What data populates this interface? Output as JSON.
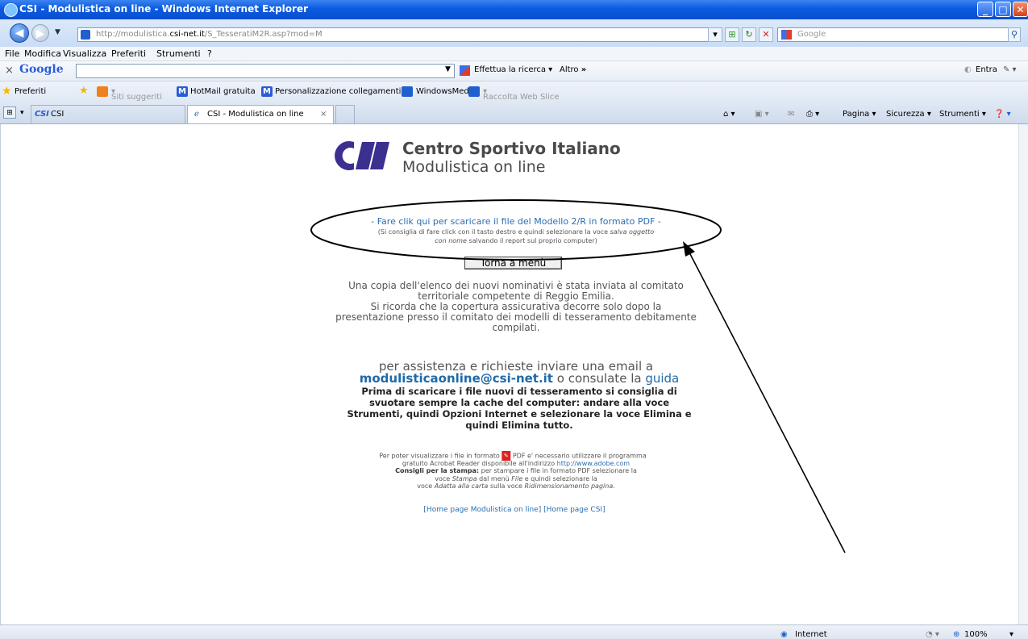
{
  "window": {
    "title": "CSI - Modulistica on line - Windows Internet Explorer"
  },
  "address": {
    "url_prefix": "http://modulistica.",
    "url_domain": "csi-net.it",
    "url_path": "/S_TesseratiM2R.asp?mod=M"
  },
  "search_box": {
    "placeholder": "Google"
  },
  "menu": [
    "File",
    "Modifica",
    "Visualizza",
    "Preferiti",
    "Strumenti",
    "?"
  ],
  "google_toolbar": {
    "logo": "Google",
    "search_label": "Effettua la ricerca",
    "more_label": "Altro",
    "more_arrows": "»",
    "signin": "Entra"
  },
  "favorites": {
    "label": "Preferiti",
    "items": [
      "Siti suggeriti",
      "HotMail gratuita",
      "Personalizzazione collegamenti",
      "WindowsMedia",
      "Raccolta Web Slice"
    ]
  },
  "tabs": [
    {
      "label": "CSI"
    },
    {
      "label": "CSI - Modulistica on line"
    }
  ],
  "commandbar": {
    "page": "Pagina",
    "safety": "Sicurezza",
    "tools": "Strumenti"
  },
  "page": {
    "title1": "Centro Sportivo Italiano",
    "title2": "Modulistica on line",
    "download_link": "- Fare clik qui per scaricare il file del Modello 2/R in formato PDF -",
    "hint_line1_a": "(Si consiglia di fare click con il tasto destro e quindi selezionare la voce ",
    "hint_line1_b": "salva oggetto",
    "hint_line2_a": "con nome",
    "hint_line2_b": " salvando il report sul proprio computer)",
    "back_button": "Torna a menù",
    "info_lines": [
      "Una copia dell'elenco dei nuovi nominativi è stata inviata al comitato",
      "territoriale competente di Reggio Emilia.",
      "Si ricorda che la copertura assicurativa decorre solo dopo la",
      "presentazione presso il comitato dei modelli di tesseramento debitamente",
      "compilati."
    ],
    "assist_line": "per assistenza e richieste inviare una email a",
    "email": "modulisticaonline@csi-net.it",
    "or_consult": " o consulate la ",
    "guide": "guida",
    "bold_lines": [
      "Prima di scaricare i file nuovi di tesseramento si consiglia di",
      "svuotare sempre la cache del computer: andare alla voce",
      "Strumenti, quindi Opzioni Internet e selezionare la voce Elimina e",
      "quindi Elimina tutto."
    ],
    "pdf_a": "Per poter visualizzare i file in formato ",
    "pdf_b": " PDF e' necessario utilizzare il programma",
    "pdf_line2": "gratuito Acrobat Reader disponibile all'indirizzo ",
    "adobe": "http://www.adobe.com",
    "print_bold": "Consigli per la stampa:",
    "print_rest": " per stampare i file in formato PDF selezionare la",
    "print_line2_a": "voce ",
    "print_line2_b": "Stampa",
    "print_line2_c": " dal menù ",
    "print_line2_d": "File",
    "print_line2_e": " e quindi selezionare la",
    "print_line3_a": "voce ",
    "print_line3_b": "Adatta alla carta",
    "print_line3_c": " sulla voce ",
    "print_line3_d": "Ridimensionamento pagina",
    "print_line3_e": ".",
    "home_links": "[Home page Modulistica on line] [Home page CSI]"
  },
  "status": {
    "zone": "Internet",
    "zoom": "100%"
  }
}
